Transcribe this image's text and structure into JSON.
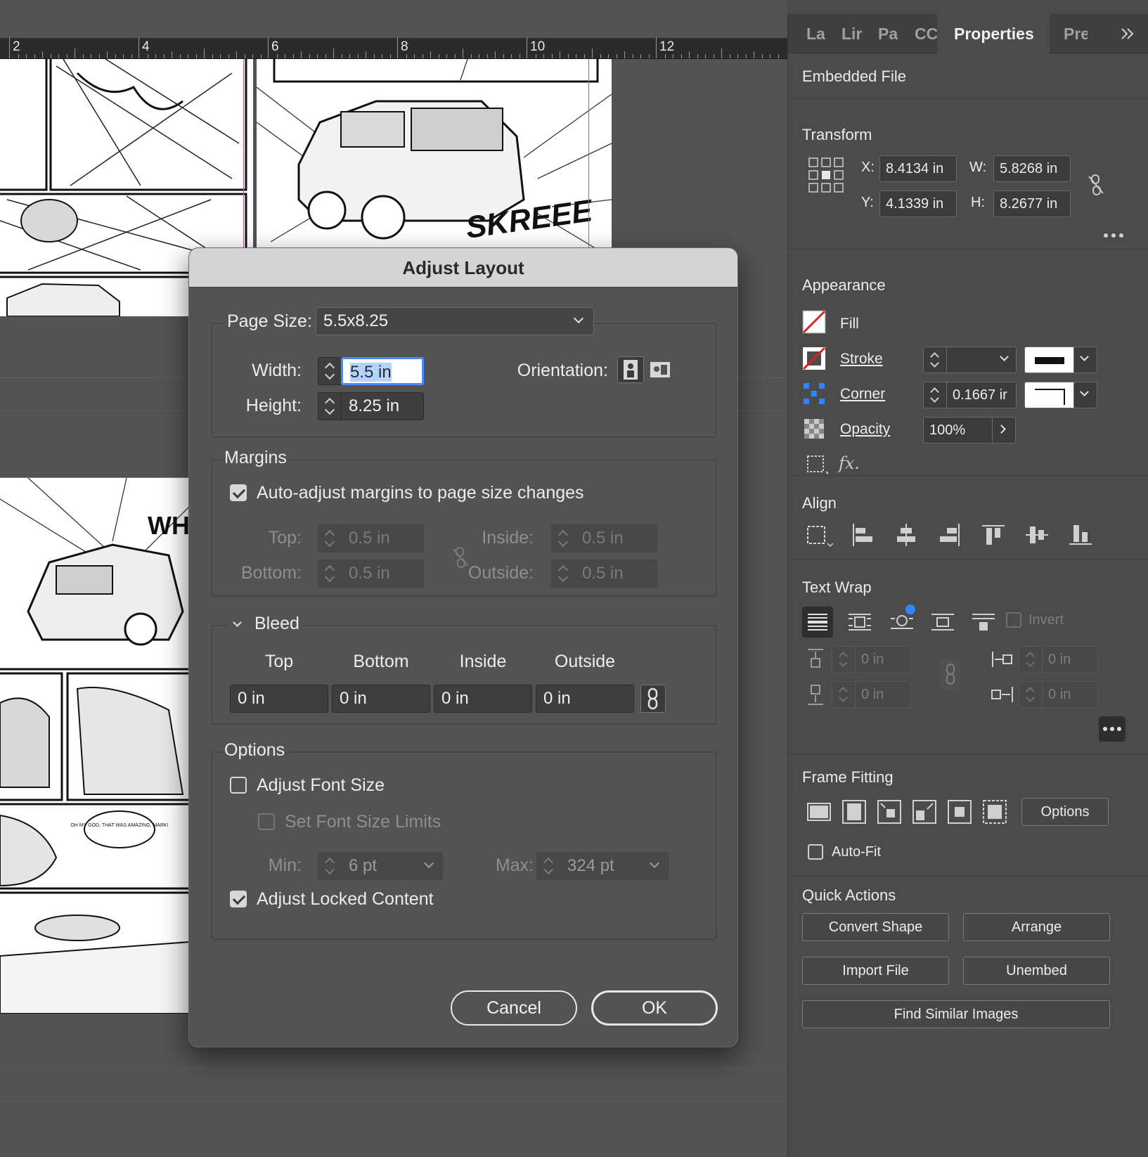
{
  "canvas": {
    "ruler_numbers": [
      "2",
      "4",
      "6",
      "8",
      "10",
      "12"
    ],
    "sfx_top": "SKREEE",
    "sfx_mid": "WHA",
    "speech_bubble": "OH MY GOD, THAT WAS AMAZING, MARK!"
  },
  "dialog": {
    "title": "Adjust Layout",
    "page_size_label": "Page Size:",
    "page_size_value": "5.5x8.25",
    "width_label": "Width:",
    "width_value": "5.5 in",
    "height_label": "Height:",
    "height_value": "8.25 in",
    "orientation_label": "Orientation:",
    "margins": {
      "legend": "Margins",
      "auto_adjust_label": "Auto-adjust margins to page size changes",
      "auto_adjust_checked": true,
      "top_label": "Top:",
      "top_value": "0.5 in",
      "bottom_label": "Bottom:",
      "bottom_value": "0.5 in",
      "inside_label": "Inside:",
      "inside_value": "0.5 in",
      "outside_label": "Outside:",
      "outside_value": "0.5 in"
    },
    "bleed": {
      "legend": "Bleed",
      "top_label": "Top",
      "bottom_label": "Bottom",
      "inside_label": "Inside",
      "outside_label": "Outside",
      "top_value": "0 in",
      "bottom_value": "0 in",
      "inside_value": "0 in",
      "outside_value": "0 in"
    },
    "options": {
      "legend": "Options",
      "adjust_font_size_label": "Adjust Font Size",
      "adjust_font_size_checked": false,
      "set_font_limits_label": "Set Font Size Limits",
      "min_label": "Min:",
      "min_value": "6 pt",
      "max_label": "Max:",
      "max_value": "324 pt",
      "adjust_locked_label": "Adjust Locked Content",
      "adjust_locked_checked": true
    },
    "cancel_label": "Cancel",
    "ok_label": "OK"
  },
  "panel": {
    "tabs": [
      "La",
      "Lir",
      "Pa",
      "CC",
      "Properties",
      "Pre"
    ],
    "active_tab": "Properties",
    "embedded_file": "Embedded File",
    "transform": {
      "title": "Transform",
      "x_label": "X:",
      "x_value": "8.4134 in",
      "y_label": "Y:",
      "y_value": "4.1339 in",
      "w_label": "W:",
      "w_value": "5.8268 in",
      "h_label": "H:",
      "h_value": "8.2677 in"
    },
    "appearance": {
      "title": "Appearance",
      "fill_label": "Fill",
      "stroke_label": "Stroke",
      "corner_label": "Corner",
      "corner_value": "0.1667 ir",
      "opacity_label": "Opacity",
      "opacity_value": "100%"
    },
    "align": {
      "title": "Align"
    },
    "text_wrap": {
      "title": "Text Wrap",
      "invert_label": "Invert",
      "top_offset": "0 in",
      "bottom_offset": "0 in",
      "left_offset": "0 in",
      "right_offset": "0 in"
    },
    "frame_fitting": {
      "title": "Frame Fitting",
      "options_label": "Options",
      "auto_fit_label": "Auto-Fit"
    },
    "quick_actions": {
      "title": "Quick Actions",
      "convert_shape": "Convert Shape",
      "arrange": "Arrange",
      "import_file": "Import File",
      "unembed": "Unembed",
      "find_similar": "Find Similar Images"
    }
  },
  "colors": {
    "accent_blue": "#2f86ff",
    "margin_guide": "#a45ad1",
    "fill_none_red": "#e02020"
  }
}
